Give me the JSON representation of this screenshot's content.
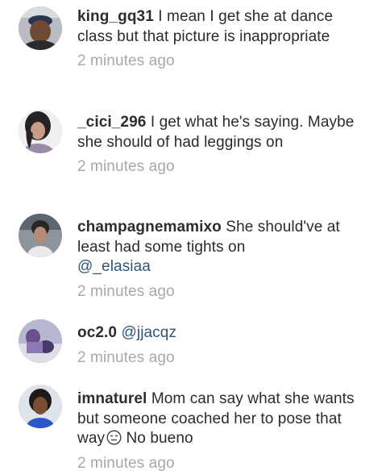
{
  "comments": [
    {
      "username": "king_gq31",
      "text": "I mean I get she at dance class but that picture is inappropriate",
      "timestamp": "2 minutes ago"
    },
    {
      "username": "_cici_296",
      "text": "I get what he's saying. Maybe she should of had leggings on",
      "timestamp": "2 minutes ago"
    },
    {
      "username": "champagnemamixo",
      "text": "She should've at least had some tights on",
      "mention": "@_elasiaa",
      "timestamp": "2 minutes ago"
    },
    {
      "username": "oc2.0",
      "mention": "@jjacqz",
      "timestamp": "2 minutes ago"
    },
    {
      "username": "imnaturel",
      "text": "Mom can say what she wants but someone coached her to pose that way",
      "text_after_emoji": "No bueno",
      "emoji": "expressionless-face-emoji",
      "timestamp": "2 minutes ago"
    }
  ]
}
